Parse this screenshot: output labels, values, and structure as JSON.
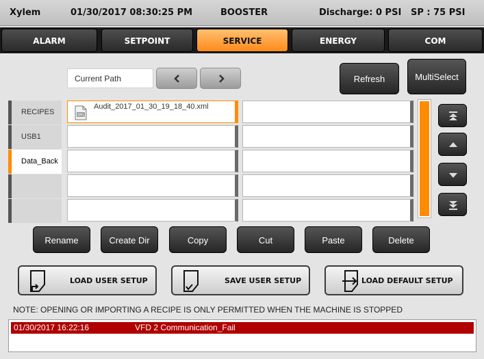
{
  "header": {
    "brand": "Xylem",
    "datetime": "01/30/2017 08:30:25 PM",
    "mode": "BOOSTER",
    "discharge": "Discharge: 0 PSI",
    "setpoint": "SP : 75 PSI"
  },
  "tabs": [
    {
      "label": "ALARM",
      "active": false
    },
    {
      "label": "SETPOINT",
      "active": false
    },
    {
      "label": "SERVICE",
      "active": true
    },
    {
      "label": "ENERGY",
      "active": false
    },
    {
      "label": "COM",
      "active": false
    }
  ],
  "path": {
    "label": "Current Path",
    "back_icon": "chevron-left-icon",
    "forward_icon": "chevron-right-icon"
  },
  "toolbar": {
    "refresh_label": "Refresh",
    "multiselect_label": "MultiSelect"
  },
  "sidebar": {
    "items": [
      {
        "label": "RECIPES",
        "active": false
      },
      {
        "label": "USB1",
        "active": false
      },
      {
        "label": "Data_Back",
        "active": true
      },
      {
        "label": "",
        "active": false
      },
      {
        "label": "",
        "active": false
      }
    ]
  },
  "files": {
    "left_column": [
      {
        "name": "Audit_2017_01_30_19_18_40.xml",
        "icon": "xml-file-icon",
        "selected": true
      },
      {
        "name": ""
      },
      {
        "name": ""
      },
      {
        "name": ""
      },
      {
        "name": ""
      }
    ],
    "right_column": [
      {
        "name": ""
      },
      {
        "name": ""
      },
      {
        "name": ""
      },
      {
        "name": ""
      },
      {
        "name": ""
      }
    ]
  },
  "scroll_buttons": [
    "scroll-top-icon",
    "scroll-up-icon",
    "scroll-down-icon",
    "scroll-bottom-icon"
  ],
  "actions": {
    "rename": "Rename",
    "create_dir": "Create Dir",
    "copy": "Copy",
    "cut": "Cut",
    "paste": "Paste",
    "delete": "Delete"
  },
  "setup": {
    "load_user": "LOAD USER SETUP",
    "save_user": "SAVE USER SETUP",
    "load_default": "LOAD DEFAULT SETUP"
  },
  "note": "NOTE:  OPENING OR IMPORTING A RECIPE IS ONLY PERMITTED WHEN THE MACHINE IS STOPPED",
  "alarm": {
    "timestamp": "01/30/2017 16:22:16",
    "message": "VFD 2 Communication_Fail"
  },
  "colors": {
    "accent": "#ff8c00",
    "alarm": "#b00000",
    "tab_active": "#ff8a1a"
  }
}
